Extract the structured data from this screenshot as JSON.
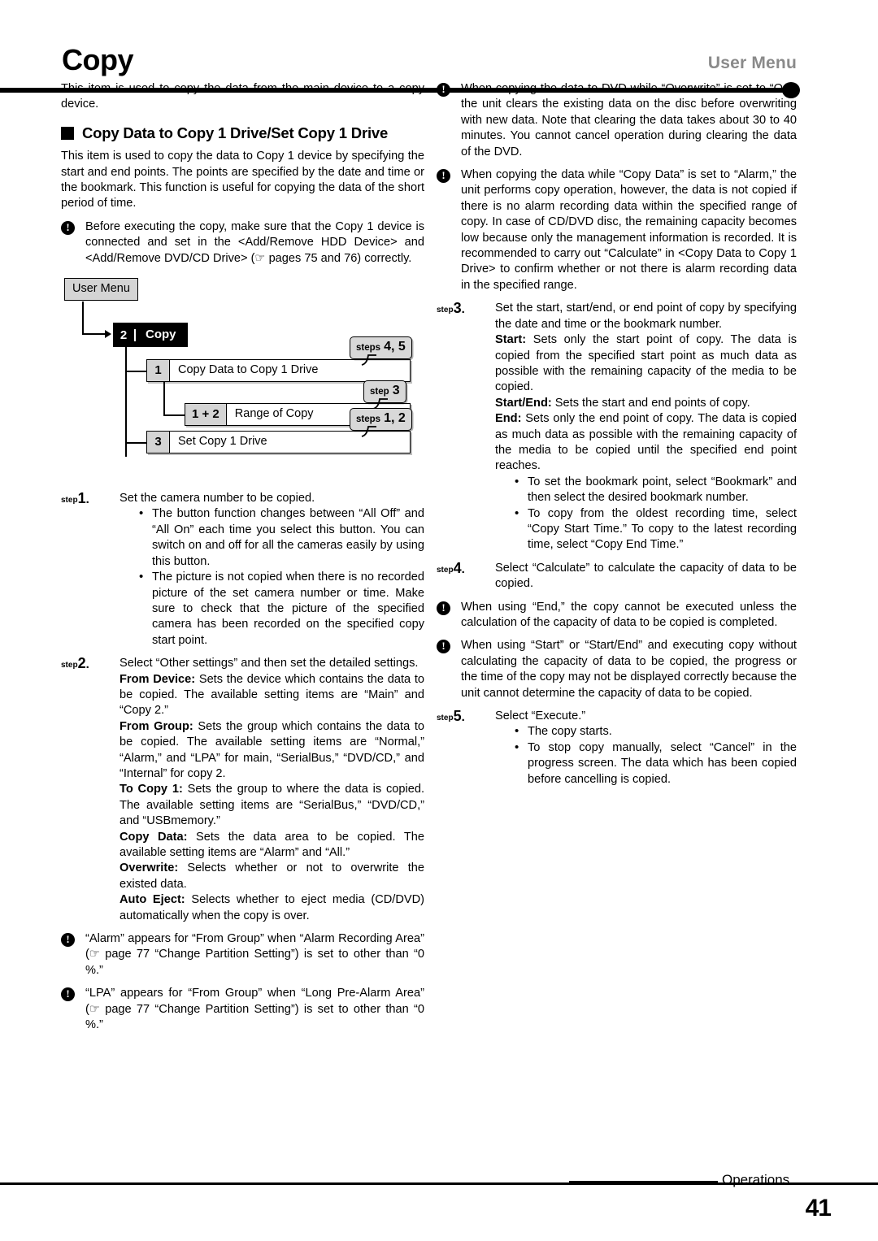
{
  "header": {
    "title": "Copy",
    "section": "User Menu"
  },
  "left_column": {
    "intro": "This item is used to copy the data from the main device to a copy device.",
    "section_heading": "Copy Data to Copy 1 Drive/Set Copy 1 Drive",
    "section_intro": "This item is used to copy the data to Copy 1 device by specifying the start and end points. The points are specified by the date and time or the bookmark. This function is useful for copying the data of the short period of time.",
    "note_1": "Before executing the copy, make sure that the Copy 1 device is connected and set in the <Add/Remove HDD Device> and <Add/Remove DVD/CD Drive> (☞ pages 75 and 76) correctly.",
    "diagram": {
      "root_label": "User Menu",
      "menu_number": "2",
      "menu_label": "Copy",
      "rows": [
        {
          "badge": "1",
          "name": "Copy Data to Copy 1 Drive"
        },
        {
          "badge": "1 + 2",
          "name": "Range of Copy"
        },
        {
          "badge": "3",
          "name": "Set Copy 1 Drive"
        }
      ],
      "callouts": [
        {
          "word": "steps",
          "num": "4, 5"
        },
        {
          "word": "step",
          "num": "3"
        },
        {
          "word": "steps",
          "num": "1, 2"
        }
      ]
    },
    "step_1": {
      "word": "step",
      "num": "1",
      "dot": ".",
      "text": "Set the camera number to be copied.",
      "bullets": [
        "The button function changes between “All Off” and “All On” each time you select this button. You can switch on and off for all the cameras easily by using this button.",
        "The picture is not copied when there is no recorded picture of the set camera number or time. Make sure to check that the picture of the specified camera has been recorded on the specified copy start point."
      ]
    },
    "step_2": {
      "word": "step",
      "num": "2",
      "dot": ".",
      "text": "Select “Other settings” and then set the detailed settings.",
      "definitions": [
        {
          "term": "From Device:",
          "desc": " Sets the device which contains the data to be copied. The available setting items are “Main” and “Copy 2.”"
        },
        {
          "term": "From Group:",
          "desc": " Sets the group which contains the data to be copied. The available setting items are “Normal,” “Alarm,” and “LPA” for main, “SerialBus,” “DVD/CD,” and “Internal” for copy 2."
        },
        {
          "term": "To Copy 1:",
          "desc": " Sets the group to where the data is copied. The available setting items are “SerialBus,” “DVD/CD,” and “USBmemory.”"
        },
        {
          "term": "Copy Data:",
          "desc": " Sets the data area to be copied. The available setting items are “Alarm” and “All.”"
        },
        {
          "term": "Overwrite:",
          "desc": " Selects whether or not to overwrite the existed data."
        },
        {
          "term": "Auto Eject:",
          "desc": " Selects whether to eject media (CD/DVD) automatically when the copy is over."
        }
      ]
    },
    "note_2": "“Alarm” appears for “From Group” when “Alarm Recording Area” (☞ page 77 “Change Partition Setting”) is set to other than “0 %.”",
    "note_3": "“LPA” appears for “From Group” when “Long Pre-Alarm Area” (☞ page 77 “Change Partition Setting”) is set to other than “0 %.”"
  },
  "right_column": {
    "note_1": "When copying the data to DVD while “Overwrite” is set to “On,” the unit clears the existing data on the disc before overwriting with new data. Note that clearing the data takes about 30 to 40 minutes. You cannot cancel operation during clearing the data of the DVD.",
    "note_2": "When copying the data while “Copy Data” is set to “Alarm,” the unit performs copy operation, however, the data is not copied if there is no alarm recording data within the specified range of copy. In case of CD/DVD disc, the remaining capacity becomes low because only the management information is recorded. It is recommended to carry out “Calculate” in <Copy Data to Copy 1 Drive> to confirm whether or not there is alarm recording data in the specified range.",
    "step_3": {
      "word": "step",
      "num": "3",
      "dot": ".",
      "text": "Set the start, start/end, or end point of copy by specifying the date and time or the bookmark number.",
      "definitions": [
        {
          "term": "Start:",
          "desc": " Sets only the start point of copy. The data is copied from the specified start point as much data as possible with the remaining capacity of the media to be copied."
        },
        {
          "term": "Start/End:",
          "desc": " Sets the start and end points of copy."
        },
        {
          "term": "End:",
          "desc": " Sets only the end point of copy. The data is copied as much data as possible with the remaining capacity of the media to be copied until the specified end point reaches."
        }
      ],
      "bullets": [
        "To set the bookmark point, select “Bookmark” and then select the desired bookmark number.",
        "To copy from the oldest recording time, select “Copy Start Time.” To copy to the latest recording time, select “Copy End Time.”"
      ]
    },
    "step_4": {
      "word": "step",
      "num": "4",
      "dot": ".",
      "text": "Select “Calculate” to calculate the capacity of data to be copied."
    },
    "note_3": "When using “End,” the copy cannot be executed unless the calculation of the capacity of data to be copied is completed.",
    "note_4": "When using “Start” or “Start/End” and executing copy without calculating the capacity of data to be copied, the progress or the time of the copy may not be displayed correctly because the unit cannot determine the capacity of data to be copied.",
    "step_5": {
      "word": "step",
      "num": "5",
      "dot": ".",
      "text": "Select “Execute.”",
      "bullets": [
        "The copy starts.",
        "To stop copy manually, select “Cancel” in the progress screen. The data which has been copied before cancelling is copied."
      ]
    }
  },
  "footer": {
    "label": "Operations",
    "page_number": "41"
  },
  "icons": {
    "note": "!",
    "hand": "☞"
  }
}
